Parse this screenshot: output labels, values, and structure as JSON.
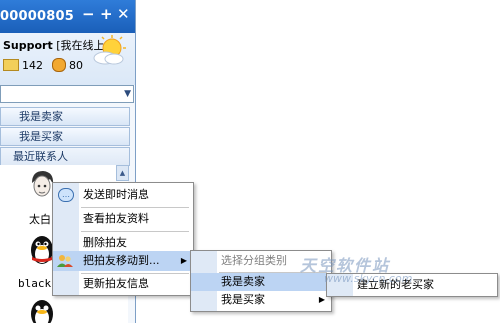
{
  "window": {
    "title_id": "00000805",
    "minimize_glyph": "−",
    "add_glyph": "+",
    "close_glyph": "✕"
  },
  "profile": {
    "name": "Support",
    "status": "[我在线上]",
    "mail_count": "142",
    "coin_count": "80",
    "weather_icon": "sun-cloud-icon"
  },
  "search": {
    "dropdown_glyph": "▼"
  },
  "groups": [
    {
      "label": "我是卖家"
    },
    {
      "label": "我是买家"
    },
    {
      "label": "最近联系人"
    }
  ],
  "friends": [
    {
      "name": "太白"
    },
    {
      "name": "blackp"
    }
  ],
  "context_menu": {
    "items": [
      {
        "label": "发送即时消息",
        "icon": "chat-bubble-icon"
      },
      {
        "label": "查看拍友资料"
      },
      {
        "label": "删除拍友"
      },
      {
        "label": "把拍友移动到...",
        "icon": "persons-icon",
        "arrow": "▶"
      },
      {
        "label": "更新拍友信息"
      }
    ]
  },
  "submenu_move": {
    "items": [
      {
        "label": "选择分组类别"
      },
      {
        "label": "我是卖家"
      },
      {
        "label": "我是买家",
        "arrow": "▶"
      }
    ]
  },
  "submenu_group": {
    "items": [
      {
        "label": "建立新的老买家"
      }
    ]
  },
  "watermark": {
    "line1": "天空软件站",
    "line2": "www.skycn.com"
  },
  "colors": {
    "titlebar": "#1a5fb9",
    "highlight": "#bcd4f3",
    "menu_strip": "#dfe9f6"
  }
}
